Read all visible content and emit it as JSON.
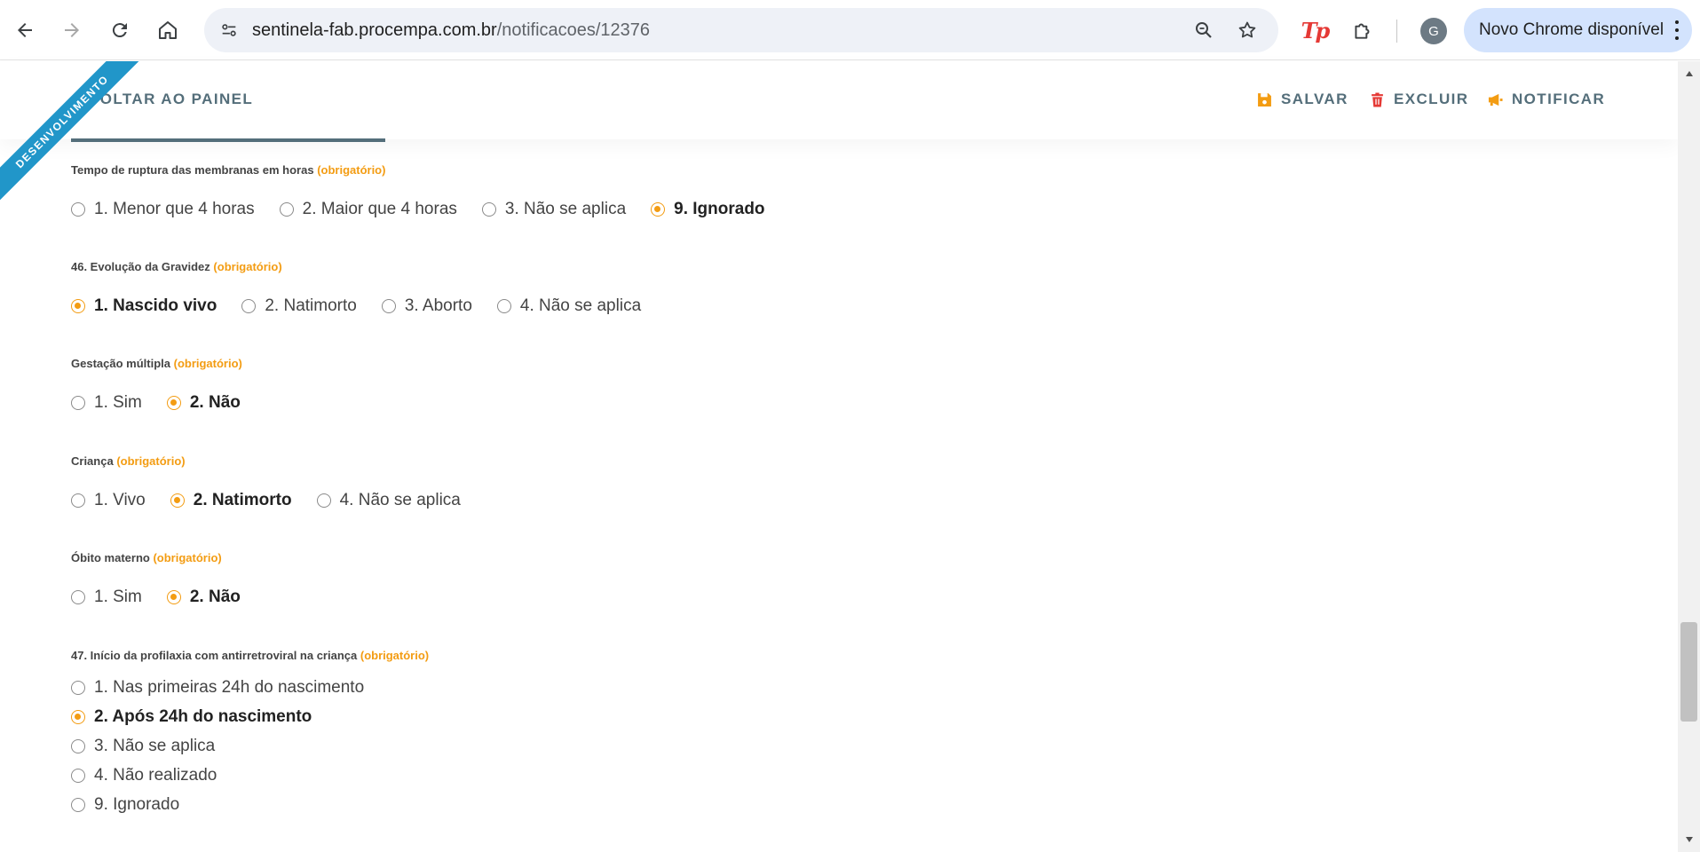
{
  "browser": {
    "url_domain": "sentinela-fab.procempa.com.br",
    "url_path": "/notificacoes/12376",
    "profile_initial": "G",
    "update_chip": "Novo Chrome disponível",
    "extension_logo": "Tp"
  },
  "header": {
    "ribbon": "DESENVOLVIMENTO",
    "back_label": "VOLTAR AO PAINEL",
    "actions": {
      "save": "SALVAR",
      "delete": "EXCLUIR",
      "notify": "NOTIFICAR"
    }
  },
  "required_text": "(obrigatório)",
  "questions": [
    {
      "label": "Tempo de ruptura das membranas em horas",
      "options": [
        "1. Menor que 4 horas",
        "2. Maior que 4 horas",
        "3. Não se aplica",
        "9. Ignorado"
      ],
      "selected": "9. Ignorado"
    },
    {
      "label": "46. Evolução da Gravidez",
      "options": [
        "1. Nascido vivo",
        "2. Natimorto",
        "3. Aborto",
        "4. Não se aplica"
      ],
      "selected": "1. Nascido vivo"
    },
    {
      "label": "Gestação múltipla",
      "options": [
        "1. Sim",
        "2. Não"
      ],
      "selected": "2. Não"
    },
    {
      "label": "Criança",
      "options": [
        "1. Vivo",
        "2. Natimorto",
        "4. Não se aplica"
      ],
      "selected": "2. Natimorto"
    },
    {
      "label": "Óbito materno",
      "options": [
        "1. Sim",
        "2. Não"
      ],
      "selected": "2. Não"
    },
    {
      "label": "47. Início da profilaxia com antirretroviral na criança",
      "options": [
        "1. Nas primeiras 24h do nascimento",
        "2. Após 24h do nascimento",
        "3. Não se aplica",
        "4. Não realizado",
        "9. Ignorado"
      ],
      "selected": "2. Após 24h do nascimento"
    }
  ],
  "colors": {
    "accent": "#f39c12",
    "header_text": "#546e7a",
    "ribbon": "#2196c9",
    "delete_icon": "#e53935"
  }
}
